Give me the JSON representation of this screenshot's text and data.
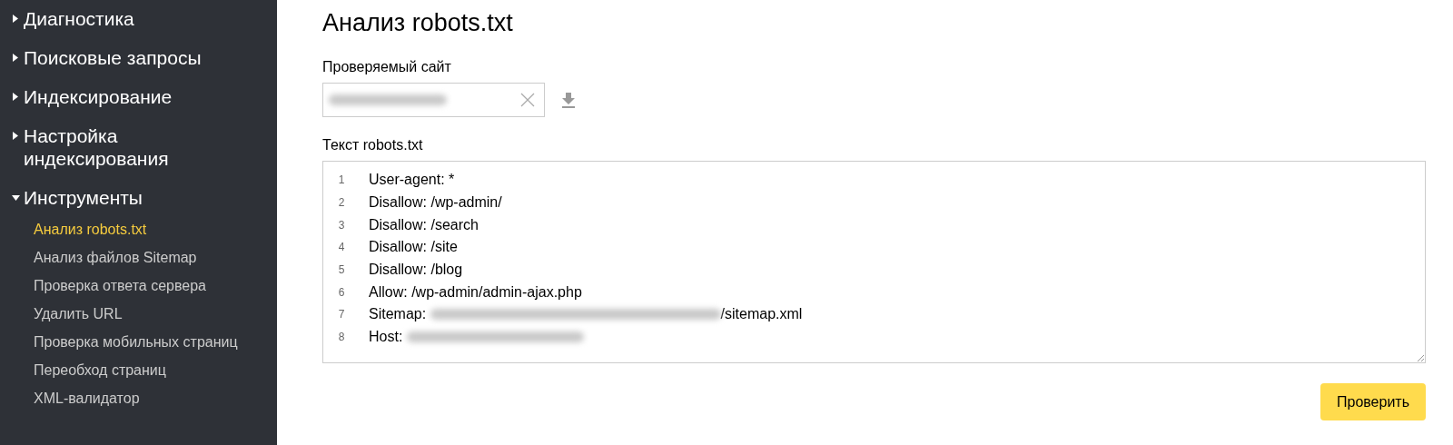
{
  "sidebar": {
    "items": [
      {
        "label": "Диагностика",
        "expanded": false
      },
      {
        "label": "Поисковые запросы",
        "expanded": false
      },
      {
        "label": "Индексирование",
        "expanded": false
      },
      {
        "label": "Настройка индексирования",
        "expanded": false
      },
      {
        "label": "Инструменты",
        "expanded": true,
        "children": [
          {
            "label": "Анализ robots.txt",
            "selected": true
          },
          {
            "label": "Анализ файлов Sitemap",
            "selected": false
          },
          {
            "label": "Проверка ответа сервера",
            "selected": false
          },
          {
            "label": "Удалить URL",
            "selected": false
          },
          {
            "label": "Проверка мобильных страниц",
            "selected": false
          },
          {
            "label": "Переобход страниц",
            "selected": false
          },
          {
            "label": "XML-валидатор",
            "selected": false
          }
        ]
      }
    ]
  },
  "main": {
    "title": "Анализ robots.txt",
    "site_label": "Проверяемый сайт",
    "site_field": {
      "blurred": true
    },
    "text_label": "Текст robots.txt",
    "code": [
      {
        "number": "1",
        "segments": [
          {
            "kind": "text",
            "text": "User-agent: *"
          }
        ]
      },
      {
        "number": "2",
        "segments": [
          {
            "kind": "text",
            "text": "Disallow: /wp-admin/"
          }
        ]
      },
      {
        "number": "3",
        "segments": [
          {
            "kind": "text",
            "text": "Disallow: /search"
          }
        ]
      },
      {
        "number": "4",
        "segments": [
          {
            "kind": "text",
            "text": "Disallow: /site"
          }
        ]
      },
      {
        "number": "5",
        "segments": [
          {
            "kind": "text",
            "text": "Disallow: /blog"
          }
        ]
      },
      {
        "number": "6",
        "segments": [
          {
            "kind": "text",
            "text": "Allow: /wp-admin/admin-ajax.php"
          }
        ]
      },
      {
        "number": "7",
        "segments": [
          {
            "kind": "text",
            "text": "Sitemap: "
          },
          {
            "kind": "blurred"
          },
          {
            "kind": "text",
            "text": "/sitemap.xml"
          }
        ]
      },
      {
        "number": "8",
        "segments": [
          {
            "kind": "text",
            "text": "Host: "
          },
          {
            "kind": "blurred"
          }
        ]
      }
    ],
    "check_button": "Проверить"
  }
}
